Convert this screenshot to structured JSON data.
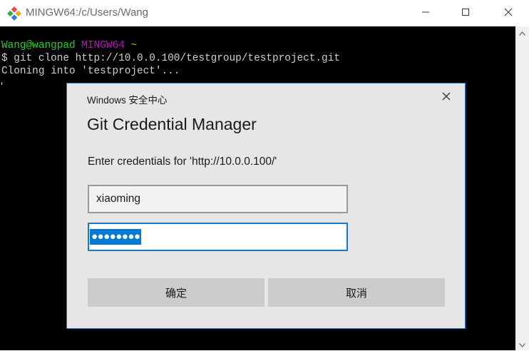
{
  "window": {
    "title": "MINGW64:/c/Users/Wang",
    "icon": "git-icon",
    "controls": [
      "minimize-icon",
      "maximize-icon",
      "close-icon"
    ]
  },
  "terminal": {
    "prompt_user": "Wang@wangpad",
    "prompt_host": "MINGW64",
    "prompt_path": "~",
    "command": "$ git clone http://10.0.0.100/testgroup/testproject.git",
    "output": "Cloning into 'testproject'..."
  },
  "dialog": {
    "caption": "Windows 安全中心",
    "heading": "Git Credential Manager",
    "prompt": "Enter credentials for 'http://10.0.0.100/'",
    "username_value": "xiaoming",
    "password_mask": "●●●●●●●●",
    "ok_label": "确定",
    "cancel_label": "取消"
  },
  "colors": {
    "accent": "#1979ca",
    "selection": "#0078d7",
    "terminal_bg": "#000000",
    "prompt_user": "#23cd23",
    "prompt_host": "#b414b4",
    "prompt_path": "#c8b400"
  }
}
